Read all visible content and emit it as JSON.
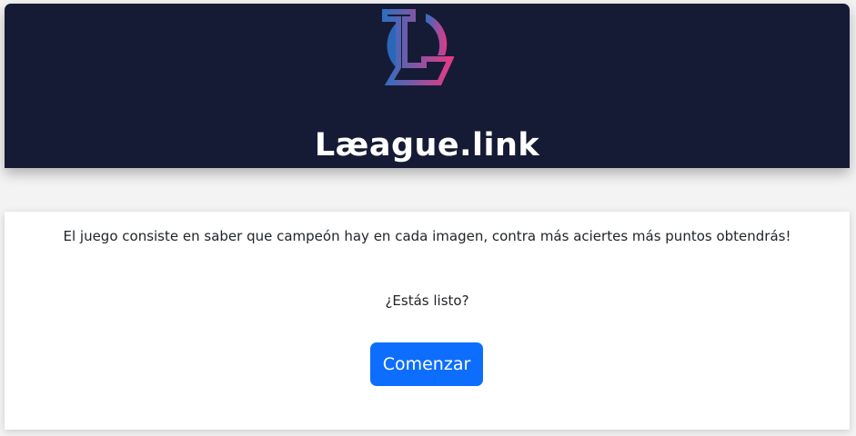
{
  "header": {
    "title": "Læague.link",
    "logo_icon": "league-link-logo-icon"
  },
  "intro": {
    "description": "El juego consiste en saber que campeón hay en cada imagen, contra más aciertes más puntos obtendrás!",
    "question": "¿Estás listo?",
    "start_button_label": "Comenzar"
  },
  "colors": {
    "header_background": "#161b35",
    "button_background": "#0d6efd",
    "logo_gradient_start": "#2f6fc0",
    "logo_gradient_end": "#e23a85"
  }
}
